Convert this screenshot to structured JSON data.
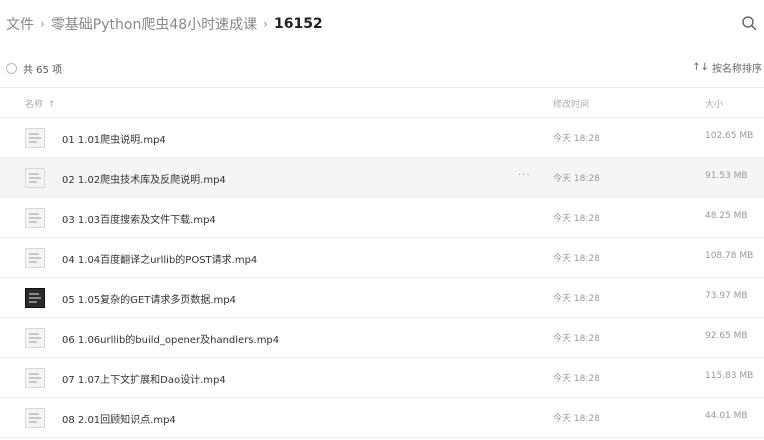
{
  "breadcrumb": {
    "items": [
      "文件",
      "零基础Python爬虫48小时速成课"
    ],
    "separator": "›",
    "current": "16152"
  },
  "search": {
    "icon": "search-icon"
  },
  "toolbar": {
    "count_label": "共 65 项",
    "sort_label": "按名称排序",
    "sort_icon": "↑↓"
  },
  "columns": {
    "name": "名称",
    "name_sort_indicator": "↑",
    "modified": "修改时间",
    "size": "大小"
  },
  "more_icon": "···",
  "files": [
    {
      "name": "01 1.01爬虫说明.mp4",
      "modified": "今天 18:28",
      "size": "102.65 MB",
      "thumb": "light",
      "hovered": false
    },
    {
      "name": "02 1.02爬虫技术库及反爬说明.mp4",
      "modified": "今天 18:28",
      "size": "91.53 MB",
      "thumb": "light",
      "hovered": true
    },
    {
      "name": "03 1.03百度搜索及文件下载.mp4",
      "modified": "今天 18:28",
      "size": "48.25 MB",
      "thumb": "light",
      "hovered": false
    },
    {
      "name": "04 1.04百度翻译之urllib的POST请求.mp4",
      "modified": "今天 18:28",
      "size": "108.78 MB",
      "thumb": "light",
      "hovered": false
    },
    {
      "name": "05 1.05复杂的GET请求多页数据.mp4",
      "modified": "今天 18:28",
      "size": "73.97 MB",
      "thumb": "dark",
      "hovered": false
    },
    {
      "name": "06 1.06urllib的build_opener及handlers.mp4",
      "modified": "今天 18:28",
      "size": "92.65 MB",
      "thumb": "light",
      "hovered": false
    },
    {
      "name": "07 1.07上下文扩展和Dao设计.mp4",
      "modified": "今天 18:28",
      "size": "115.83 MB",
      "thumb": "light",
      "hovered": false
    },
    {
      "name": "08 2.01回顾知识点.mp4",
      "modified": "今天 18:28",
      "size": "44.01 MB",
      "thumb": "light",
      "hovered": false
    }
  ]
}
